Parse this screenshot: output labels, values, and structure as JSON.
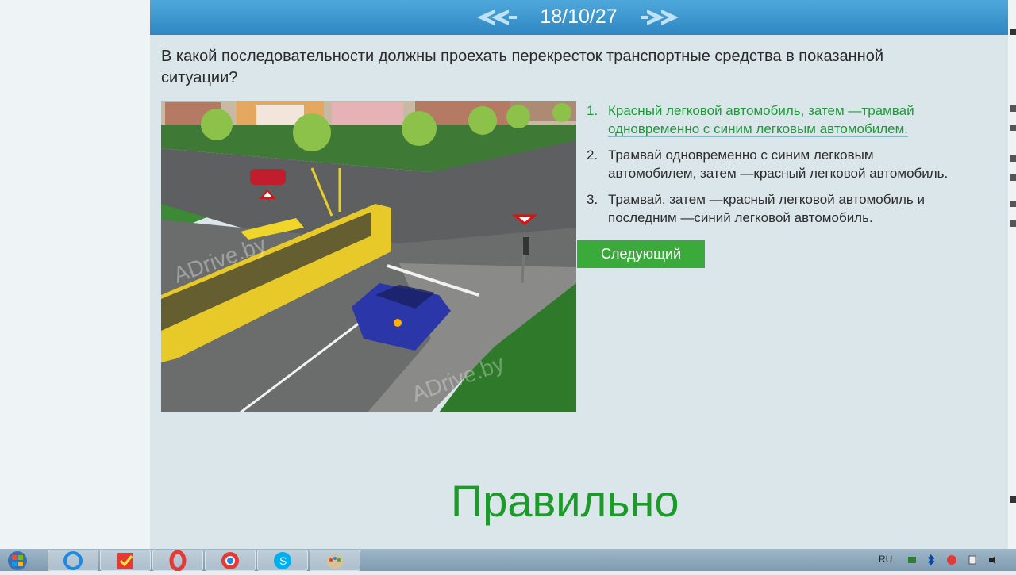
{
  "header": {
    "ticket_number": "18/10/27",
    "prev_icon": "double-chevron-left-icon",
    "next_icon": "double-chevron-right-icon",
    "background_color": "#3a93cf"
  },
  "question": {
    "text": "В какой последовательности должны проехать перекресток транспортные средства в показанной ситуации?"
  },
  "scene": {
    "watermark": "ADrive.by"
  },
  "answers": [
    {
      "number": "1.",
      "line1": "Красный легковой автомобиль, затем —трамвай",
      "line2": "одновременно с синим легковым автомобилем.",
      "state": "correct"
    },
    {
      "number": "2.",
      "line1": "Трамвай одновременно с синим легковым",
      "line2": "автомобилем, затем —красный легковой автомобиль.",
      "state": "normal"
    },
    {
      "number": "3.",
      "line1": "Трамвай, затем —красный легковой автомобиль и",
      "line2": "последним —синий легковой автомобиль.",
      "state": "normal"
    }
  ],
  "next_button": {
    "label": "Следующий"
  },
  "result": {
    "text": "Правильно",
    "color": "#1c9b2a"
  },
  "taskbar": {
    "language": "RU",
    "apps": [
      "windows-start-icon",
      "internet-explorer-icon",
      "checklist-app-icon",
      "opera-icon",
      "chrome-icon",
      "skype-icon",
      "paint-icon"
    ]
  }
}
